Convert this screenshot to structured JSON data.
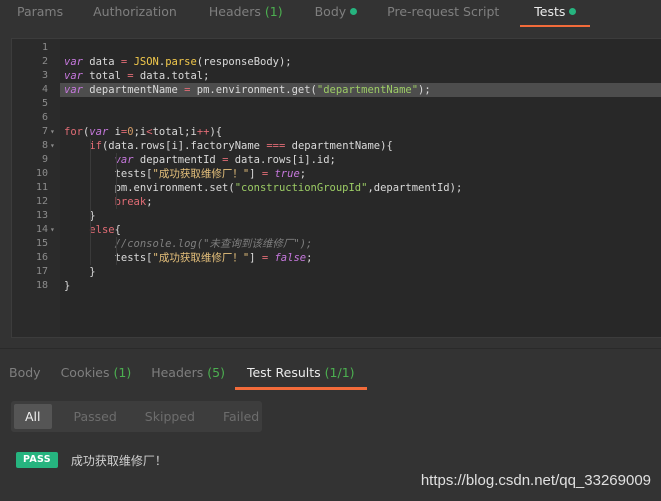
{
  "request_tabs": [
    {
      "label": "Params",
      "count": "",
      "dot": false,
      "active": false
    },
    {
      "label": "Authorization",
      "count": "",
      "dot": false,
      "active": false
    },
    {
      "label": "Headers",
      "count": "(1)",
      "dot": false,
      "active": false
    },
    {
      "label": "Body",
      "count": "",
      "dot": true,
      "active": false
    },
    {
      "label": "Pre-request Script",
      "count": "",
      "dot": false,
      "active": false
    },
    {
      "label": "Tests",
      "count": "",
      "dot": true,
      "active": true
    }
  ],
  "editor": {
    "line_numbers": [
      "1",
      "2",
      "3",
      "4",
      "5",
      "6",
      "7",
      "8",
      "9",
      "10",
      "11",
      "12",
      "13",
      "14",
      "15",
      "16",
      "17",
      "18"
    ],
    "fold_lines": [
      7,
      8,
      14
    ],
    "highlighted_line": 4,
    "lines": [
      "",
      "var data = JSON.parse(responseBody);",
      "var total = data.total;",
      "var departmentName = pm.environment.get(\"departmentName\");",
      "",
      "",
      "for(var i=0;i<total;i++){",
      "    if(data.rows[i].factoryName === departmentName){",
      "        var departmentId = data.rows[i].id;",
      "        tests[\"成功获取维修厂！\"] = true;",
      "        pm.environment.set(\"constructionGroupId\",departmentId);",
      "        break;",
      "    }",
      "    else{",
      "        //console.log(\"未查询到该维修厂\");",
      "        tests[\"成功获取维修厂！\"] = false;",
      "    }",
      "}"
    ]
  },
  "response_tabs": [
    {
      "label": "Body",
      "count": "",
      "active": false
    },
    {
      "label": "Cookies",
      "count": "(1)",
      "active": false
    },
    {
      "label": "Headers",
      "count": "(5)",
      "active": false
    },
    {
      "label": "Test Results",
      "count": "(1/1)",
      "active": true
    }
  ],
  "filters": [
    "All",
    "Passed",
    "Skipped",
    "Failed"
  ],
  "active_filter": "All",
  "results": [
    {
      "status": "PASS",
      "name": "成功获取维修厂！"
    }
  ],
  "watermark": "https://blog.csdn.net/qq_33269009",
  "colors": {
    "accent": "#f26b3a",
    "pass": "#26b47f",
    "background": "#333333",
    "editor_bg": "#282828"
  }
}
